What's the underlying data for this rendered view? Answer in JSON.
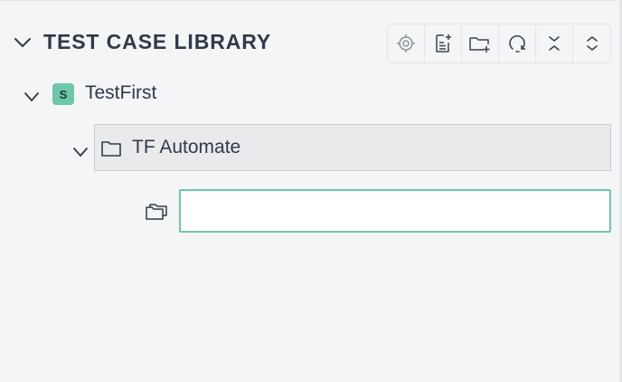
{
  "library": {
    "title": "TEST CASE LIBRARY",
    "toolbar": [
      {
        "icon": "locate-icon",
        "action": "locate"
      },
      {
        "icon": "add-test-case-icon",
        "action": "add-test-case"
      },
      {
        "icon": "add-folder-icon",
        "action": "add-folder"
      },
      {
        "icon": "refresh-icon",
        "action": "refresh"
      },
      {
        "icon": "collapse-all-icon",
        "action": "collapse-all"
      },
      {
        "icon": "expand-all-icon",
        "action": "expand-all"
      }
    ]
  },
  "tree": {
    "suite": {
      "badge": "S",
      "label": "TestFirst",
      "badge_color": "#6ec6ac"
    },
    "folder": {
      "label": "TF Automate",
      "selected": true
    },
    "new_folder": {
      "value": "",
      "placeholder": ""
    }
  },
  "colors": {
    "background": "#f4f5f7",
    "text": "#2f3a4a",
    "accent": "#6ec6ac",
    "selected_row": "#e9eaec"
  }
}
